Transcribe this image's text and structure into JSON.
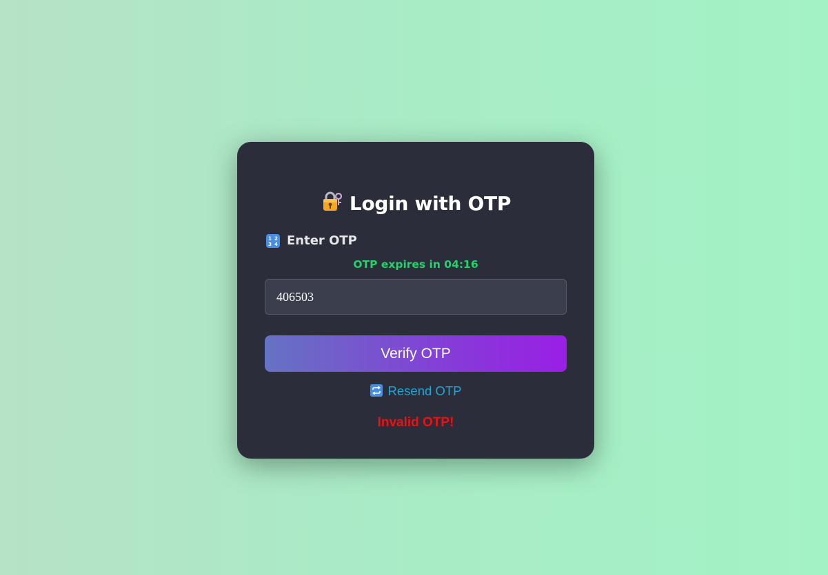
{
  "login": {
    "title": "Login with OTP",
    "title_icon": "locked-with-key-icon",
    "label": "Enter OTP",
    "label_icon": "input-numbers-icon",
    "label_icon_glyph": "1 2\n3 4",
    "timer_text": "OTP expires in 04:16",
    "otp_value": "406503",
    "verify_label": "Verify OTP",
    "resend_label": "Resend OTP",
    "resend_icon": "repeat-icon",
    "resend_icon_glyph": "🔁",
    "error_text": "Invalid OTP!"
  },
  "colors": {
    "background_start": "#b6e2c6",
    "background_end": "#a3f2c5",
    "card": "#2b2d3a",
    "timer": "#22d36a",
    "button_start": "#6573c3",
    "button_end": "#9a1fe6",
    "link": "#19a9d8",
    "error": "#ee1111"
  }
}
